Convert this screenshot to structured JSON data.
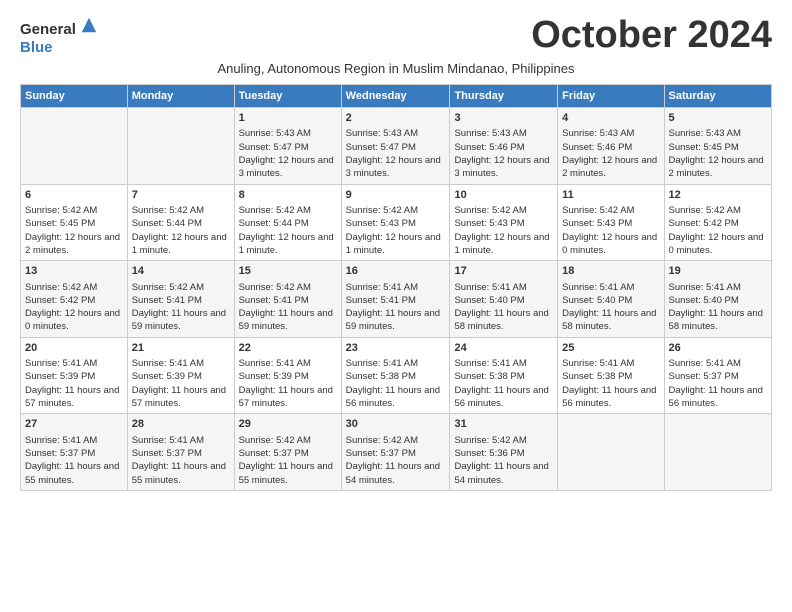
{
  "header": {
    "logo_general": "General",
    "logo_blue": "Blue",
    "month_title": "October 2024",
    "subtitle": "Anuling, Autonomous Region in Muslim Mindanao, Philippines"
  },
  "days_of_week": [
    "Sunday",
    "Monday",
    "Tuesday",
    "Wednesday",
    "Thursday",
    "Friday",
    "Saturday"
  ],
  "weeks": [
    [
      {
        "day": "",
        "sunrise": "",
        "sunset": "",
        "daylight": ""
      },
      {
        "day": "",
        "sunrise": "",
        "sunset": "",
        "daylight": ""
      },
      {
        "day": "1",
        "sunrise": "Sunrise: 5:43 AM",
        "sunset": "Sunset: 5:47 PM",
        "daylight": "Daylight: 12 hours and 3 minutes."
      },
      {
        "day": "2",
        "sunrise": "Sunrise: 5:43 AM",
        "sunset": "Sunset: 5:47 PM",
        "daylight": "Daylight: 12 hours and 3 minutes."
      },
      {
        "day": "3",
        "sunrise": "Sunrise: 5:43 AM",
        "sunset": "Sunset: 5:46 PM",
        "daylight": "Daylight: 12 hours and 3 minutes."
      },
      {
        "day": "4",
        "sunrise": "Sunrise: 5:43 AM",
        "sunset": "Sunset: 5:46 PM",
        "daylight": "Daylight: 12 hours and 2 minutes."
      },
      {
        "day": "5",
        "sunrise": "Sunrise: 5:43 AM",
        "sunset": "Sunset: 5:45 PM",
        "daylight": "Daylight: 12 hours and 2 minutes."
      }
    ],
    [
      {
        "day": "6",
        "sunrise": "Sunrise: 5:42 AM",
        "sunset": "Sunset: 5:45 PM",
        "daylight": "Daylight: 12 hours and 2 minutes."
      },
      {
        "day": "7",
        "sunrise": "Sunrise: 5:42 AM",
        "sunset": "Sunset: 5:44 PM",
        "daylight": "Daylight: 12 hours and 1 minute."
      },
      {
        "day": "8",
        "sunrise": "Sunrise: 5:42 AM",
        "sunset": "Sunset: 5:44 PM",
        "daylight": "Daylight: 12 hours and 1 minute."
      },
      {
        "day": "9",
        "sunrise": "Sunrise: 5:42 AM",
        "sunset": "Sunset: 5:43 PM",
        "daylight": "Daylight: 12 hours and 1 minute."
      },
      {
        "day": "10",
        "sunrise": "Sunrise: 5:42 AM",
        "sunset": "Sunset: 5:43 PM",
        "daylight": "Daylight: 12 hours and 1 minute."
      },
      {
        "day": "11",
        "sunrise": "Sunrise: 5:42 AM",
        "sunset": "Sunset: 5:43 PM",
        "daylight": "Daylight: 12 hours and 0 minutes."
      },
      {
        "day": "12",
        "sunrise": "Sunrise: 5:42 AM",
        "sunset": "Sunset: 5:42 PM",
        "daylight": "Daylight: 12 hours and 0 minutes."
      }
    ],
    [
      {
        "day": "13",
        "sunrise": "Sunrise: 5:42 AM",
        "sunset": "Sunset: 5:42 PM",
        "daylight": "Daylight: 12 hours and 0 minutes."
      },
      {
        "day": "14",
        "sunrise": "Sunrise: 5:42 AM",
        "sunset": "Sunset: 5:41 PM",
        "daylight": "Daylight: 11 hours and 59 minutes."
      },
      {
        "day": "15",
        "sunrise": "Sunrise: 5:42 AM",
        "sunset": "Sunset: 5:41 PM",
        "daylight": "Daylight: 11 hours and 59 minutes."
      },
      {
        "day": "16",
        "sunrise": "Sunrise: 5:41 AM",
        "sunset": "Sunset: 5:41 PM",
        "daylight": "Daylight: 11 hours and 59 minutes."
      },
      {
        "day": "17",
        "sunrise": "Sunrise: 5:41 AM",
        "sunset": "Sunset: 5:40 PM",
        "daylight": "Daylight: 11 hours and 58 minutes."
      },
      {
        "day": "18",
        "sunrise": "Sunrise: 5:41 AM",
        "sunset": "Sunset: 5:40 PM",
        "daylight": "Daylight: 11 hours and 58 minutes."
      },
      {
        "day": "19",
        "sunrise": "Sunrise: 5:41 AM",
        "sunset": "Sunset: 5:40 PM",
        "daylight": "Daylight: 11 hours and 58 minutes."
      }
    ],
    [
      {
        "day": "20",
        "sunrise": "Sunrise: 5:41 AM",
        "sunset": "Sunset: 5:39 PM",
        "daylight": "Daylight: 11 hours and 57 minutes."
      },
      {
        "day": "21",
        "sunrise": "Sunrise: 5:41 AM",
        "sunset": "Sunset: 5:39 PM",
        "daylight": "Daylight: 11 hours and 57 minutes."
      },
      {
        "day": "22",
        "sunrise": "Sunrise: 5:41 AM",
        "sunset": "Sunset: 5:39 PM",
        "daylight": "Daylight: 11 hours and 57 minutes."
      },
      {
        "day": "23",
        "sunrise": "Sunrise: 5:41 AM",
        "sunset": "Sunset: 5:38 PM",
        "daylight": "Daylight: 11 hours and 56 minutes."
      },
      {
        "day": "24",
        "sunrise": "Sunrise: 5:41 AM",
        "sunset": "Sunset: 5:38 PM",
        "daylight": "Daylight: 11 hours and 56 minutes."
      },
      {
        "day": "25",
        "sunrise": "Sunrise: 5:41 AM",
        "sunset": "Sunset: 5:38 PM",
        "daylight": "Daylight: 11 hours and 56 minutes."
      },
      {
        "day": "26",
        "sunrise": "Sunrise: 5:41 AM",
        "sunset": "Sunset: 5:37 PM",
        "daylight": "Daylight: 11 hours and 56 minutes."
      }
    ],
    [
      {
        "day": "27",
        "sunrise": "Sunrise: 5:41 AM",
        "sunset": "Sunset: 5:37 PM",
        "daylight": "Daylight: 11 hours and 55 minutes."
      },
      {
        "day": "28",
        "sunrise": "Sunrise: 5:41 AM",
        "sunset": "Sunset: 5:37 PM",
        "daylight": "Daylight: 11 hours and 55 minutes."
      },
      {
        "day": "29",
        "sunrise": "Sunrise: 5:42 AM",
        "sunset": "Sunset: 5:37 PM",
        "daylight": "Daylight: 11 hours and 55 minutes."
      },
      {
        "day": "30",
        "sunrise": "Sunrise: 5:42 AM",
        "sunset": "Sunset: 5:37 PM",
        "daylight": "Daylight: 11 hours and 54 minutes."
      },
      {
        "day": "31",
        "sunrise": "Sunrise: 5:42 AM",
        "sunset": "Sunset: 5:36 PM",
        "daylight": "Daylight: 11 hours and 54 minutes."
      },
      {
        "day": "",
        "sunrise": "",
        "sunset": "",
        "daylight": ""
      },
      {
        "day": "",
        "sunrise": "",
        "sunset": "",
        "daylight": ""
      }
    ]
  ]
}
